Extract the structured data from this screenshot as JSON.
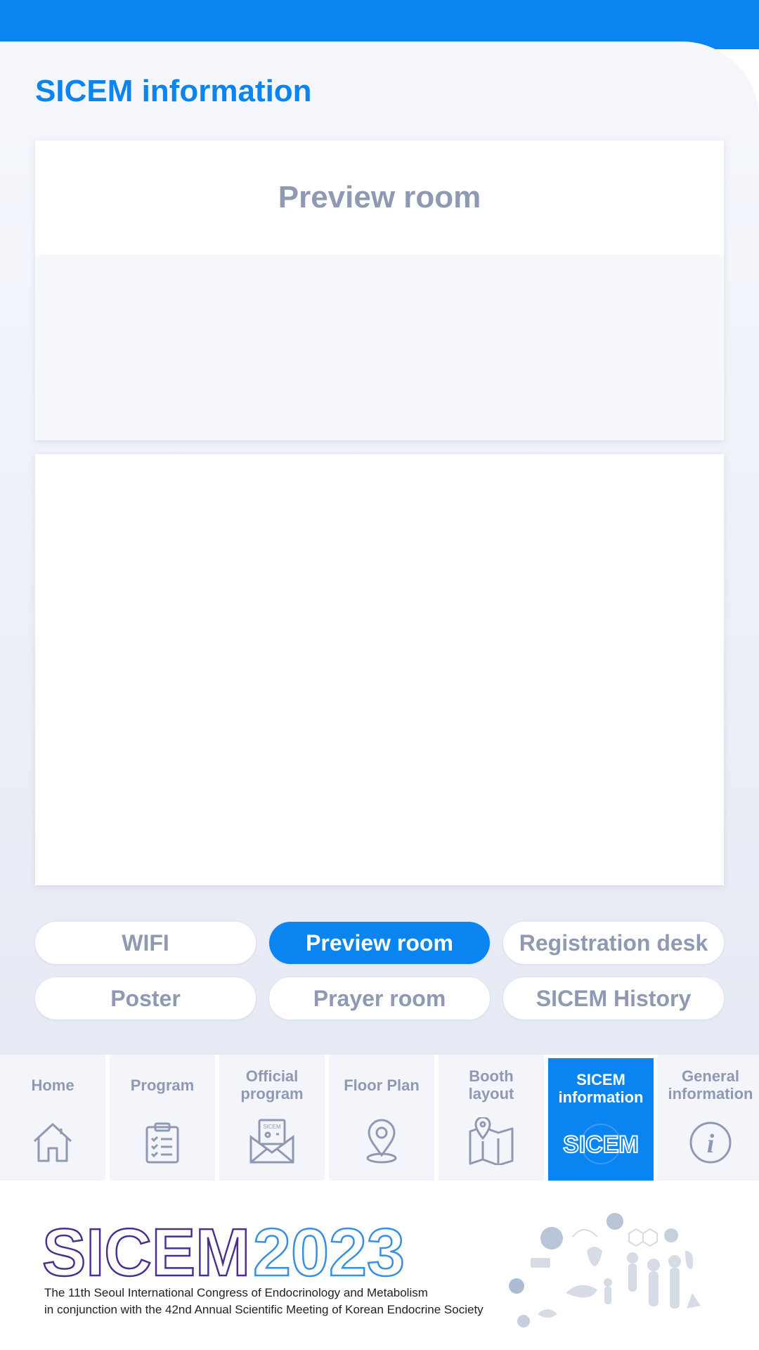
{
  "page": {
    "title": "SICEM information"
  },
  "preview_card": {
    "title": "Preview room"
  },
  "tabs": [
    {
      "label": "WIFI",
      "active": false
    },
    {
      "label": "Preview room",
      "active": true
    },
    {
      "label": "Registration desk",
      "active": false
    },
    {
      "label": "Poster",
      "active": false
    },
    {
      "label": "Prayer room",
      "active": false
    },
    {
      "label": "SICEM History",
      "active": false
    }
  ],
  "nav": [
    {
      "label": "Home",
      "icon": "home-icon"
    },
    {
      "label": "Program",
      "icon": "clipboard-icon"
    },
    {
      "label": "Official\nprogram",
      "icon": "envelope-icon",
      "icon_text": "SICEM"
    },
    {
      "label": "Floor Plan",
      "icon": "location-pin-icon"
    },
    {
      "label": "Booth\nlayout",
      "icon": "map-icon"
    },
    {
      "label": "SICEM\ninformation",
      "icon": "sicem-logo-icon",
      "icon_text": "SICEM",
      "active": true
    },
    {
      "label": "General\ninformation",
      "icon": "info-icon",
      "icon_text": "i"
    }
  ],
  "footer": {
    "logo_text": "SICEM",
    "logo_year": "2023",
    "tagline_line1": "The 11th Seoul International Congress of Endocrinology and Metabolism",
    "tagline_line2": "in conjunction with the 42nd Annual Scientific Meeting of Korean Endocrine Society"
  },
  "colors": {
    "primary": "#0A84F0",
    "muted_text": "#8f9ab2",
    "logo_purple": "#4a2f8c",
    "logo_blue": "#3a8fe0"
  }
}
